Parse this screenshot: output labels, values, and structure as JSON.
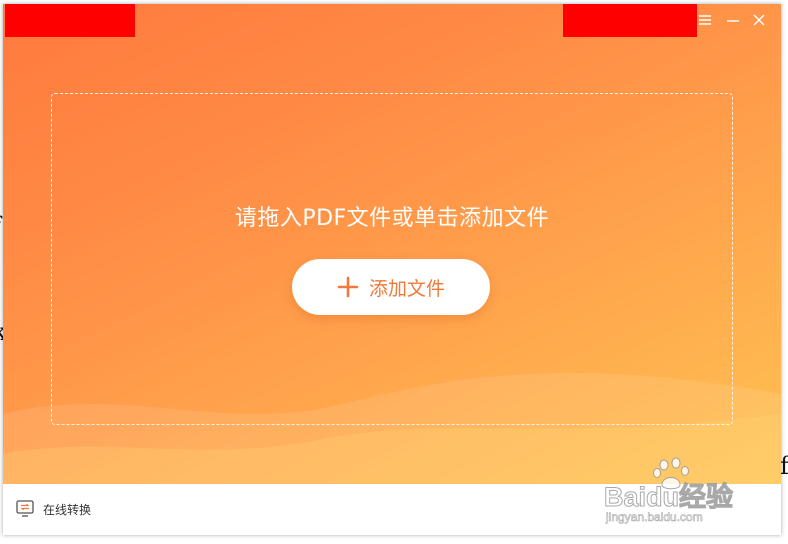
{
  "window": {
    "controls": {
      "menu_icon": "menu-icon",
      "minimize_icon": "minimize-icon",
      "close_icon": "close-icon"
    }
  },
  "drop_zone": {
    "hint": "请拖入PDF文件或单击添加文件",
    "add_button_label": "添加文件",
    "add_button_icon": "plus-icon"
  },
  "footer": {
    "online_convert_label": "在线转换",
    "online_convert_icon": "convert-monitor-icon"
  },
  "watermark": {
    "main": "Baidu经验",
    "sub": "jingyan.baidu.com"
  },
  "colors": {
    "gradient_start": "#ff7a3d",
    "gradient_end": "#ffc252",
    "accent": "#f07a3a",
    "redaction": "#ff0000"
  }
}
